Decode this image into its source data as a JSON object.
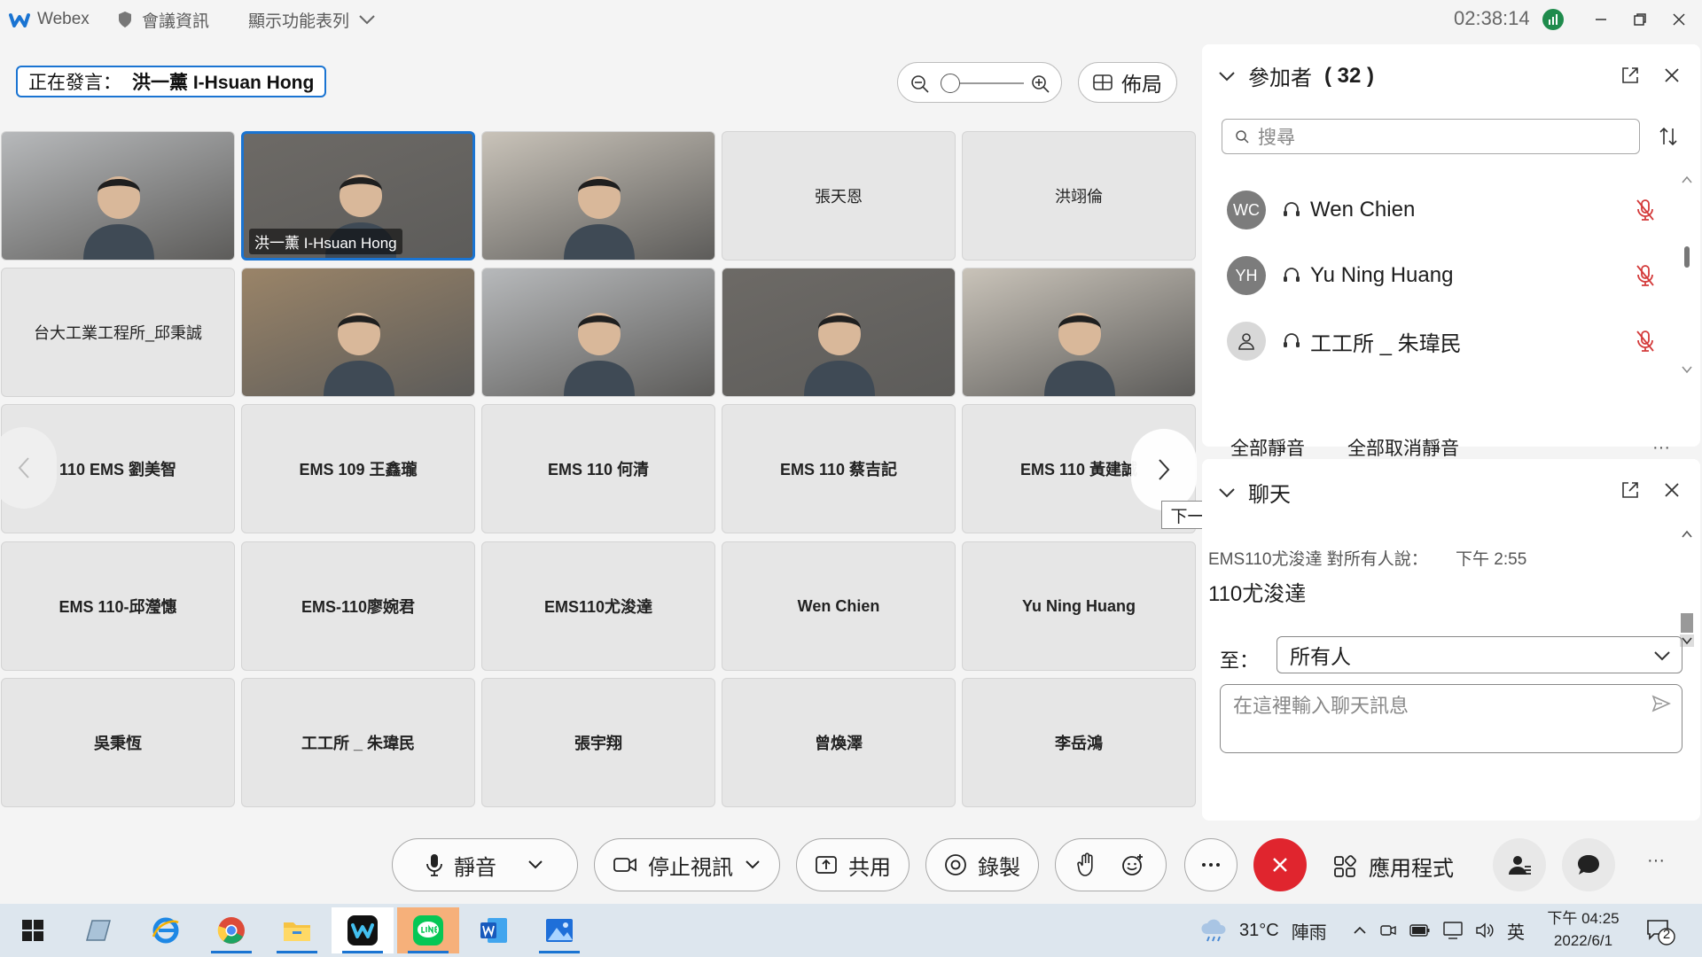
{
  "titlebar": {
    "app_name": "Webex",
    "meeting_info": "會議資訊",
    "show_menu": "顯示功能表列",
    "time": "02:38:14"
  },
  "speaker": {
    "prefix": "正在發言：",
    "name": "洪一薰 I-Hsuan Hong"
  },
  "toolbar": {
    "layout_label": "佈局"
  },
  "grid": {
    "tiles": [
      {
        "name": "",
        "video": true
      },
      {
        "name": "洪一薰 I-Hsuan Hong",
        "video": true,
        "active": true
      },
      {
        "name": "",
        "video": true
      },
      {
        "name": "張天恩",
        "video": false
      },
      {
        "name": "洪翊倫",
        "video": false
      },
      {
        "name": "台大工業工程所_邱秉誠",
        "video": false
      },
      {
        "name": "",
        "video": true
      },
      {
        "name": "",
        "video": true
      },
      {
        "name": "",
        "video": true
      },
      {
        "name": "",
        "video": true
      },
      {
        "name": "110 EMS 劉美智",
        "video": false
      },
      {
        "name": "EMS 109 王鑫瓏",
        "video": false
      },
      {
        "name": "EMS 110 何清",
        "video": false
      },
      {
        "name": "EMS 110 蔡吉記",
        "video": false
      },
      {
        "name": "EMS 110 黃建誠",
        "video": false
      },
      {
        "name": "EMS 110-邱瀅憓",
        "video": false
      },
      {
        "name": "EMS-110廖婉君",
        "video": false
      },
      {
        "name": "EMS110尤浚達",
        "video": false
      },
      {
        "name": "Wen Chien",
        "video": false
      },
      {
        "name": "Yu Ning Huang",
        "video": false
      },
      {
        "name": "吳秉恆",
        "video": false
      },
      {
        "name": "工工所 _ 朱瑋民",
        "video": false
      },
      {
        "name": "張宇翔",
        "video": false
      },
      {
        "name": "曾煥澤",
        "video": false
      },
      {
        "name": "李岳鴻",
        "video": false
      }
    ],
    "next_tooltip": "下一頁"
  },
  "participants": {
    "title": "參加者",
    "count": "( 32 )",
    "search_placeholder": "搜尋",
    "list": [
      {
        "initials": "WC",
        "name": "Wen Chien"
      },
      {
        "initials": "YH",
        "name": "Yu Ning Huang"
      },
      {
        "initials": "",
        "name": "工工所 _ 朱瑋民"
      }
    ],
    "mute_all": "全部靜音",
    "unmute_all": "全部取消靜音"
  },
  "chat": {
    "title": "聊天",
    "message_header": "EMS110尤浚達 對所有人說：",
    "message_time": "下午 2:55",
    "message_body": "110尤浚達",
    "to_label": "至：",
    "to_value": "所有人",
    "input_placeholder": "在這裡輸入聊天訊息"
  },
  "controls": {
    "mute": "靜音",
    "stop_video": "停止視訊",
    "share": "共用",
    "record": "錄製",
    "apps": "應用程式"
  },
  "taskbar": {
    "weather": "31°C",
    "weather_desc": "陣雨",
    "ime": "英",
    "time": "下午 04:25",
    "date": "2022/6/1",
    "notif_count": "2"
  },
  "colors": {
    "accent": "#1a74d2",
    "end_call": "#e0252e"
  }
}
